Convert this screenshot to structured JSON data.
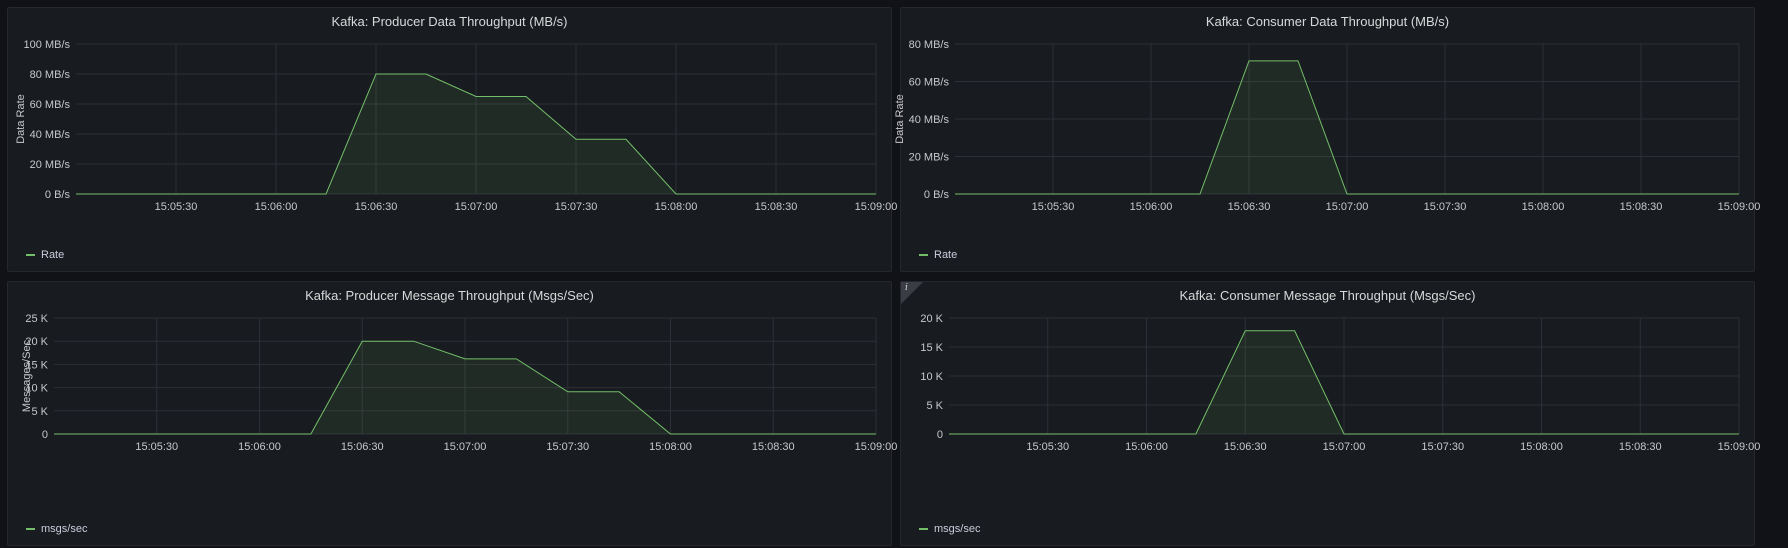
{
  "colors": {
    "series": "#73bf69",
    "grid": "#2c2f36",
    "tick_text": "#c7c8cc",
    "background": "#181b1f"
  },
  "panels": [
    {
      "title": "Kafka: Producer Data Throughput (MB/s)",
      "legend": "Rate",
      "info_icon": false
    },
    {
      "title": "Kafka: Consumer Data Throughput (MB/s)",
      "legend": "Rate",
      "info_icon": false
    },
    {
      "title": "Kafka: Producer Message Throughput (Msgs/Sec)",
      "legend": "msgs/sec",
      "info_icon": false
    },
    {
      "title": "Kafka: Consumer Message Throughput (Msgs/Sec)",
      "legend": "msgs/sec",
      "info_icon": true,
      "info_icon_name": "info-icon"
    }
  ],
  "chart_data": [
    {
      "type": "area",
      "title": "Kafka: Producer Data Throughput (MB/s)",
      "ylabel": "Data Rate",
      "xlabel": "",
      "xlim": [
        "15:05:00",
        "15:09:00"
      ],
      "ylim": [
        0,
        100
      ],
      "y_ticks": [
        "0 B/s",
        "20 MB/s",
        "40 MB/s",
        "60 MB/s",
        "80 MB/s",
        "100 MB/s"
      ],
      "x_ticks": [
        "15:05:30",
        "15:06:00",
        "15:06:30",
        "15:07:00",
        "15:07:30",
        "15:08:00",
        "15:08:30",
        "15:09:00"
      ],
      "grid": true,
      "legend_position": "bottom-left",
      "series": [
        {
          "name": "Rate",
          "x": [
            "15:05:00",
            "15:06:15",
            "15:06:30",
            "15:06:45",
            "15:07:00",
            "15:07:15",
            "15:07:30",
            "15:07:45",
            "15:08:00",
            "15:09:00"
          ],
          "y": [
            0,
            0,
            80,
            80,
            65,
            65,
            36.5,
            36.5,
            0,
            0
          ]
        }
      ]
    },
    {
      "type": "area",
      "title": "Kafka: Consumer Data Throughput (MB/s)",
      "ylabel": "Data Rate",
      "xlabel": "",
      "xlim": [
        "15:05:00",
        "15:09:00"
      ],
      "ylim": [
        0,
        80
      ],
      "y_ticks": [
        "0 B/s",
        "20 MB/s",
        "40 MB/s",
        "60 MB/s",
        "80 MB/s"
      ],
      "x_ticks": [
        "15:05:30",
        "15:06:00",
        "15:06:30",
        "15:07:00",
        "15:07:30",
        "15:08:00",
        "15:08:30",
        "15:09:00"
      ],
      "grid": true,
      "legend_position": "bottom-left",
      "series": [
        {
          "name": "Rate",
          "x": [
            "15:05:00",
            "15:06:15",
            "15:06:30",
            "15:06:45",
            "15:07:00",
            "15:09:00"
          ],
          "y": [
            0,
            0,
            71,
            71,
            0,
            0
          ]
        }
      ]
    },
    {
      "type": "area",
      "title": "Kafka: Producer Message Throughput (Msgs/Sec)",
      "ylabel": "Messages/Sec",
      "xlabel": "",
      "xlim": [
        "15:05:00",
        "15:09:00"
      ],
      "ylim": [
        0,
        25000
      ],
      "y_ticks": [
        "0",
        "5 K",
        "10 K",
        "15 K",
        "20 K",
        "25 K"
      ],
      "x_ticks": [
        "15:05:30",
        "15:06:00",
        "15:06:30",
        "15:07:00",
        "15:07:30",
        "15:08:00",
        "15:08:30",
        "15:09:00"
      ],
      "grid": true,
      "legend_position": "bottom-left",
      "series": [
        {
          "name": "msgs/sec",
          "x": [
            "15:05:00",
            "15:06:15",
            "15:06:30",
            "15:06:45",
            "15:07:00",
            "15:07:15",
            "15:07:30",
            "15:07:45",
            "15:08:00",
            "15:09:00"
          ],
          "y": [
            0,
            0,
            20000,
            20000,
            16200,
            16200,
            9100,
            9100,
            0,
            0
          ]
        }
      ]
    },
    {
      "type": "area",
      "title": "Kafka: Consumer Message Throughput (Msgs/Sec)",
      "ylabel": "",
      "xlabel": "",
      "xlim": [
        "15:05:00",
        "15:09:00"
      ],
      "ylim": [
        0,
        20000
      ],
      "y_ticks": [
        "0",
        "5 K",
        "10 K",
        "15 K",
        "20 K"
      ],
      "x_ticks": [
        "15:05:30",
        "15:06:00",
        "15:06:30",
        "15:07:00",
        "15:07:30",
        "15:08:00",
        "15:08:30",
        "15:09:00"
      ],
      "grid": true,
      "legend_position": "bottom-left",
      "series": [
        {
          "name": "msgs/sec",
          "x": [
            "15:05:00",
            "15:06:15",
            "15:06:30",
            "15:06:45",
            "15:07:00",
            "15:09:00"
          ],
          "y": [
            0,
            0,
            17800,
            17800,
            0,
            0
          ]
        }
      ]
    }
  ]
}
